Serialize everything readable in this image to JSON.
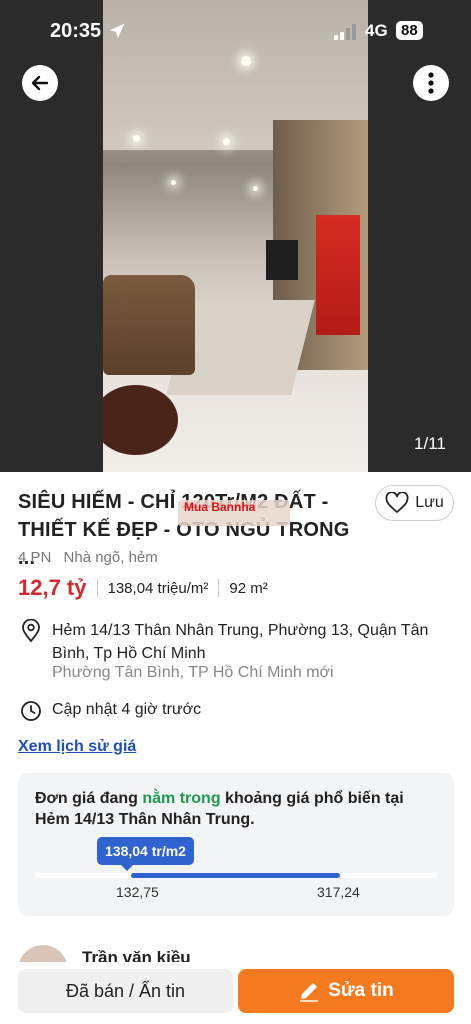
{
  "status": {
    "time": "20:35",
    "network": "4G",
    "battery": "88"
  },
  "gallery": {
    "counter": "1/11"
  },
  "listing": {
    "title": "SIÊU HIẾM - CHỈ 120Tr/M2 ĐẤT - THIẾT KẾ ĐẸP - OTO NGỦ TRONG ...",
    "save_label": "Lưu",
    "watermark_text": "Mua Bannha",
    "bedrooms": "4 PN",
    "type": "Nhà ngõ, hẻm",
    "price": "12,7 tỷ",
    "price_per_m2": "138,04 triệu/m²",
    "area": "92 m²",
    "address": "Hẻm 14/13 Thân Nhân Trung, Phường 13, Quận Tân Bình, Tp Hồ Chí Minh",
    "address_new": "Phường Tân Bình, TP Hồ Chí Minh mới",
    "updated": "Cập nhật 4 giờ trước",
    "price_history_link": "Xem lịch sử giá"
  },
  "price_card": {
    "text_before": "Đơn giá đang ",
    "text_highlight": "nằm trong",
    "text_after": " khoảng giá phổ biến tại Hẻm 14/13 Thân Nhân Trung.",
    "current": "138,04 tr/m2",
    "low": "132,75",
    "high": "317,24"
  },
  "agent": {
    "name": "Trần văn kiều"
  },
  "actions": {
    "sold_label": "Đã bán / Ẩn tin",
    "edit_label": "Sửa tin"
  },
  "colors": {
    "price_red": "#d7282f",
    "accent_orange": "#f57a1f",
    "range_blue": "#2f63cf",
    "link_blue": "#1e4fb8",
    "highlight_green": "#1d9a4f"
  },
  "icons": [
    "back-arrow-icon",
    "more-vertical-icon",
    "heart-icon",
    "location-pin-icon",
    "clock-icon",
    "pencil-icon",
    "navigation-arrow-icon",
    "signal-icon"
  ]
}
